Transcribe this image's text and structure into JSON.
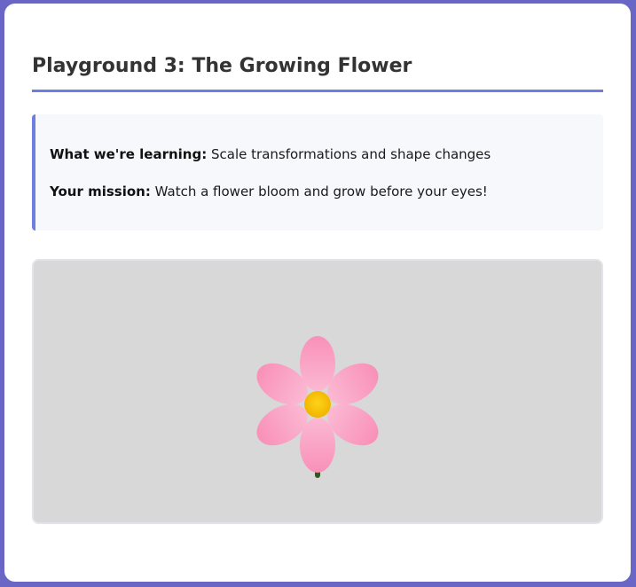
{
  "page": {
    "title": "Playground 3: The Growing Flower"
  },
  "info": {
    "learning_label": "What we're learning:",
    "learning_text": "Scale transformations and shape changes",
    "mission_label": "Your mission:",
    "mission_text": "Watch a flower bloom and grow before your eyes!"
  },
  "colors": {
    "background": "#6a66c6",
    "accent": "#6c7ee0",
    "stage": "#d8d8d8",
    "petal": "#f7a1c0",
    "center": "#f5c000",
    "stem": "#2f5a1c"
  },
  "flower": {
    "petal_count": 6
  }
}
